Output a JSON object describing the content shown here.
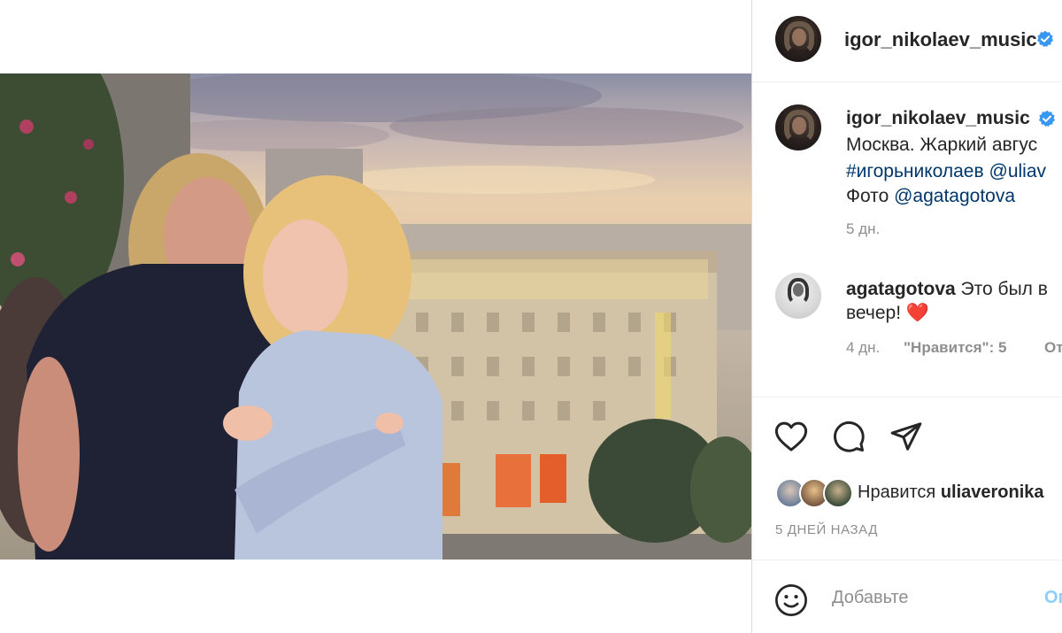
{
  "post": {
    "author": "igor_nikolaev_music",
    "caption_author": "igor_nikolaev_music",
    "caption_lines": {
      "line1": "Москва. Жаркий авгус",
      "hashtag": "#игорьниколаев",
      "mention1": "@uliav",
      "photo_prefix": "Фото",
      "mention2": "@agatagotova"
    },
    "caption_time": "5 дн.",
    "comment": {
      "author": "agatagotova",
      "text_line1": "Это был в",
      "text_line2": "вечер!",
      "emoji": "❤️",
      "time": "4 дн.",
      "likes_label": "\"Нравится\": 5",
      "reply_label": "От"
    },
    "likes": {
      "prefix": "Нравится",
      "user": "uliaveronika"
    },
    "time_ago": "5 ДНЕЙ НАЗАД",
    "comment_placeholder": "Добавьте",
    "post_button": "Оп"
  },
  "icons": {
    "like": "heart-icon",
    "comment": "comment-icon",
    "share": "paper-plane-icon",
    "emoji": "smiley-icon",
    "verified": "verified-badge-icon"
  },
  "colors": {
    "link": "#00376b",
    "verified": "#3897f0",
    "muted": "#8e8e8e",
    "heart": "#ed4956"
  }
}
